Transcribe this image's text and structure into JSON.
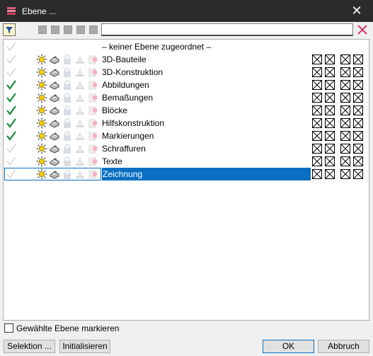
{
  "window": {
    "title": "Ebene ...",
    "close_glyph": "✕"
  },
  "toolbar": {
    "search_value": "",
    "filter_icon": "filter-icon",
    "clear_icon": "clear-x-icon"
  },
  "list": {
    "rows": [
      {
        "label": "– keiner Ebene zugeordnet –",
        "checked": false,
        "icons": false,
        "xboxes": false,
        "selected": false
      },
      {
        "label": "3D-Bauteile",
        "checked": false,
        "icons": true,
        "xboxes": true,
        "selected": false
      },
      {
        "label": "3D-Konstruktion",
        "checked": false,
        "icons": true,
        "xboxes": true,
        "selected": false
      },
      {
        "label": "Abbildungen",
        "checked": true,
        "icons": true,
        "xboxes": true,
        "selected": false
      },
      {
        "label": "Bemaßungen",
        "checked": true,
        "icons": true,
        "xboxes": true,
        "selected": false
      },
      {
        "label": "Blöcke",
        "checked": true,
        "icons": true,
        "xboxes": true,
        "selected": false
      },
      {
        "label": "Hilfskonstruktion",
        "checked": true,
        "icons": true,
        "xboxes": true,
        "selected": false
      },
      {
        "label": "Markierungen",
        "checked": true,
        "icons": true,
        "xboxes": true,
        "selected": false
      },
      {
        "label": "Schraffuren",
        "checked": false,
        "icons": true,
        "xboxes": true,
        "selected": false
      },
      {
        "label": "Texte",
        "checked": false,
        "icons": true,
        "xboxes": true,
        "selected": false
      },
      {
        "label": "Zeichnung",
        "checked": false,
        "icons": true,
        "xboxes": true,
        "selected": true
      }
    ]
  },
  "options": {
    "mark_selected_label": "Gewählte Ebene markieren",
    "mark_selected_checked": false
  },
  "buttons": {
    "selection": "Selektion ...",
    "initialize": "Initialisieren",
    "ok": "OK",
    "cancel": "Abbruch"
  },
  "colors": {
    "selection": "#0a6fc2",
    "check_on": "#1b8a3e",
    "check_off": "#cfcfcf"
  }
}
